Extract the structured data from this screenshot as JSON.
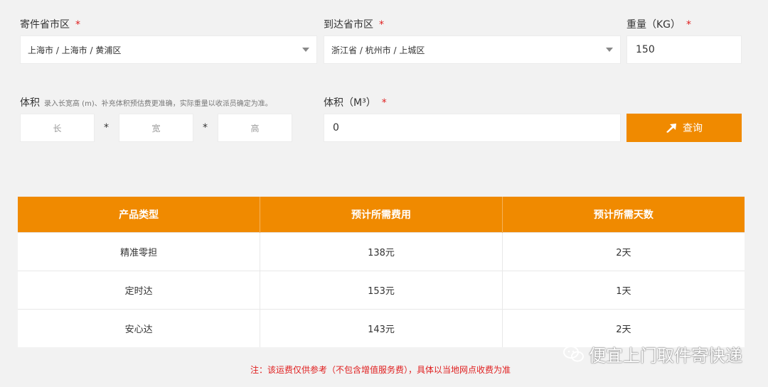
{
  "form": {
    "origin": {
      "label": "寄件省市区",
      "required": "*",
      "value": "上海市 / 上海市 / 黄浦区"
    },
    "destination": {
      "label": "到达省市区",
      "required": "*",
      "value": "浙江省 / 杭州市 / 上城区"
    },
    "weight": {
      "label": "重量（KG）",
      "required": "*",
      "value": "150"
    },
    "dimensions": {
      "label": "体积",
      "hint": "录入长宽高 (m)、补充体积预估费更准确，实际重量以收派员确定为准。",
      "length_placeholder": "长",
      "width_placeholder": "宽",
      "height_placeholder": "高",
      "times_sign": "*"
    },
    "volume": {
      "label": "体积（M³）",
      "required": "*",
      "value": "0"
    },
    "query_button": {
      "label": "查询",
      "icon": "arrow-icon"
    }
  },
  "result_table": {
    "headers": [
      "产品类型",
      "预计所需费用",
      "预计所需天数"
    ],
    "rows": [
      [
        "精准零担",
        "138元",
        "2天"
      ],
      [
        "定时达",
        "153元",
        "1天"
      ],
      [
        "安心达",
        "143元",
        "2天"
      ]
    ]
  },
  "note": "注：该运费仅供参考（不包含增值服务费），具体以当地网点收费为准",
  "watermark": {
    "text": "便宜上门取件寄快递",
    "icon": "wechat-icon"
  },
  "colors": {
    "accent": "#f08a00",
    "required": "#e02020",
    "background": "#f2f2f2"
  }
}
